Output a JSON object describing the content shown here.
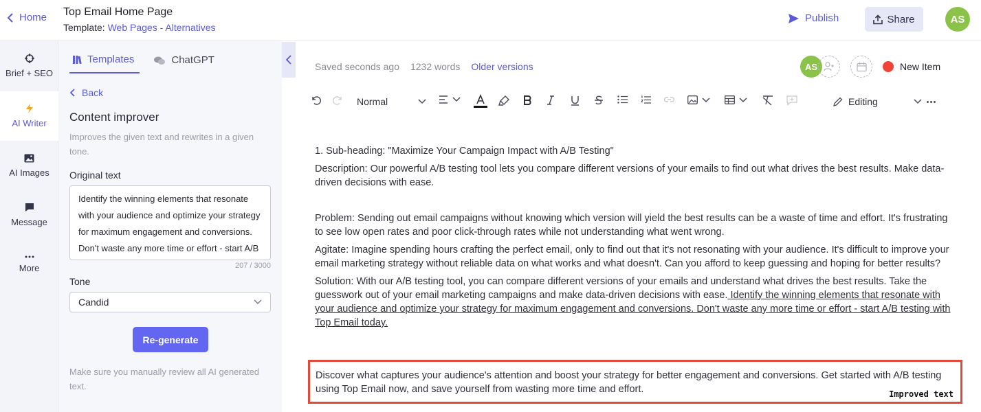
{
  "header": {
    "home_label": "Home",
    "doc_title": "Top Email Home Page",
    "template_prefix": "Template:",
    "template_name": "Web Pages - Alternatives",
    "publish_label": "Publish",
    "share_label": "Share",
    "avatar_initials": "AS"
  },
  "rail": {
    "items": [
      {
        "label": "Brief + SEO",
        "icon": "crosshair-icon"
      },
      {
        "label": "AI Writer",
        "icon": "lightning-icon"
      },
      {
        "label": "AI Images",
        "icon": "image-icon"
      },
      {
        "label": "Message",
        "icon": "chat-icon"
      },
      {
        "label": "More",
        "icon": "more-icon"
      }
    ],
    "active": "AI Writer"
  },
  "panel": {
    "tabs": [
      {
        "label": "Templates"
      },
      {
        "label": "ChatGPT"
      }
    ],
    "back_label": "Back",
    "title": "Content improver",
    "description": "Improves the given text and rewrites in a given tone.",
    "original_label": "Original text",
    "original_text": "Identify the winning elements that resonate with your audience and optimize your strategy for maximum engagement and conversions. Don't waste any more time or effort - start A/B testing with Top Email today.",
    "counter": "207 / 3000",
    "tone_label": "Tone",
    "tone_value": "Candid",
    "regenerate_label": "Re-generate",
    "note": "Make sure you manually review all AI generated text."
  },
  "editor": {
    "saved_status": "Saved seconds ago",
    "word_count": "1232 words",
    "older_versions": "Older versions",
    "collab_initials": "AS",
    "new_item_label": "New Item",
    "toolbar": {
      "paragraph_style": "Normal",
      "mode": "Editing"
    },
    "content": {
      "subheading": "1. Sub-heading: \"Maximize Your Campaign Impact with A/B Testing\"",
      "description": "Description: Our powerful A/B testing tool lets you compare different versions of your emails to find out what drives the best results. Make data-driven decisions with ease.",
      "problem": "Problem: Sending out email campaigns without knowing which version will yield the best results can be a waste of time and effort. It's frustrating to see low open rates and poor click-through rates while not understanding what went wrong.",
      "agitate": "Agitate: Imagine spending hours crafting the perfect email, only to find out that it's not resonating with your audience. It's difficult to improve your email marketing strategy without reliable data on what works and what doesn't. Can you afford to keep guessing and hoping for better results?",
      "solution_plain": "Solution: With our A/B testing tool, you can compare different versions of your emails and understand what drives the best results. Take the guesswork out of your email marketing campaigns and make data-driven decisions with ease.",
      "solution_underlined": " Identify the winning elements that resonate with your audience and optimize your strategy for maximum engagement and conversions. Don't waste any more time or effort - start A/B testing with Top Email today."
    },
    "improved": {
      "text": "Discover what captures your audience's attention and boost your strategy for better engagement and conversions. Get started with A/B testing using Top Email now, and save yourself from wasting more time and effort.",
      "label": "Improved text",
      "border_color": "#e04a3a"
    }
  },
  "colors": {
    "accent": "#5b5bd6",
    "button": "#6366f1",
    "avatar": "#8bc34a",
    "status_dot": "#f04438"
  }
}
